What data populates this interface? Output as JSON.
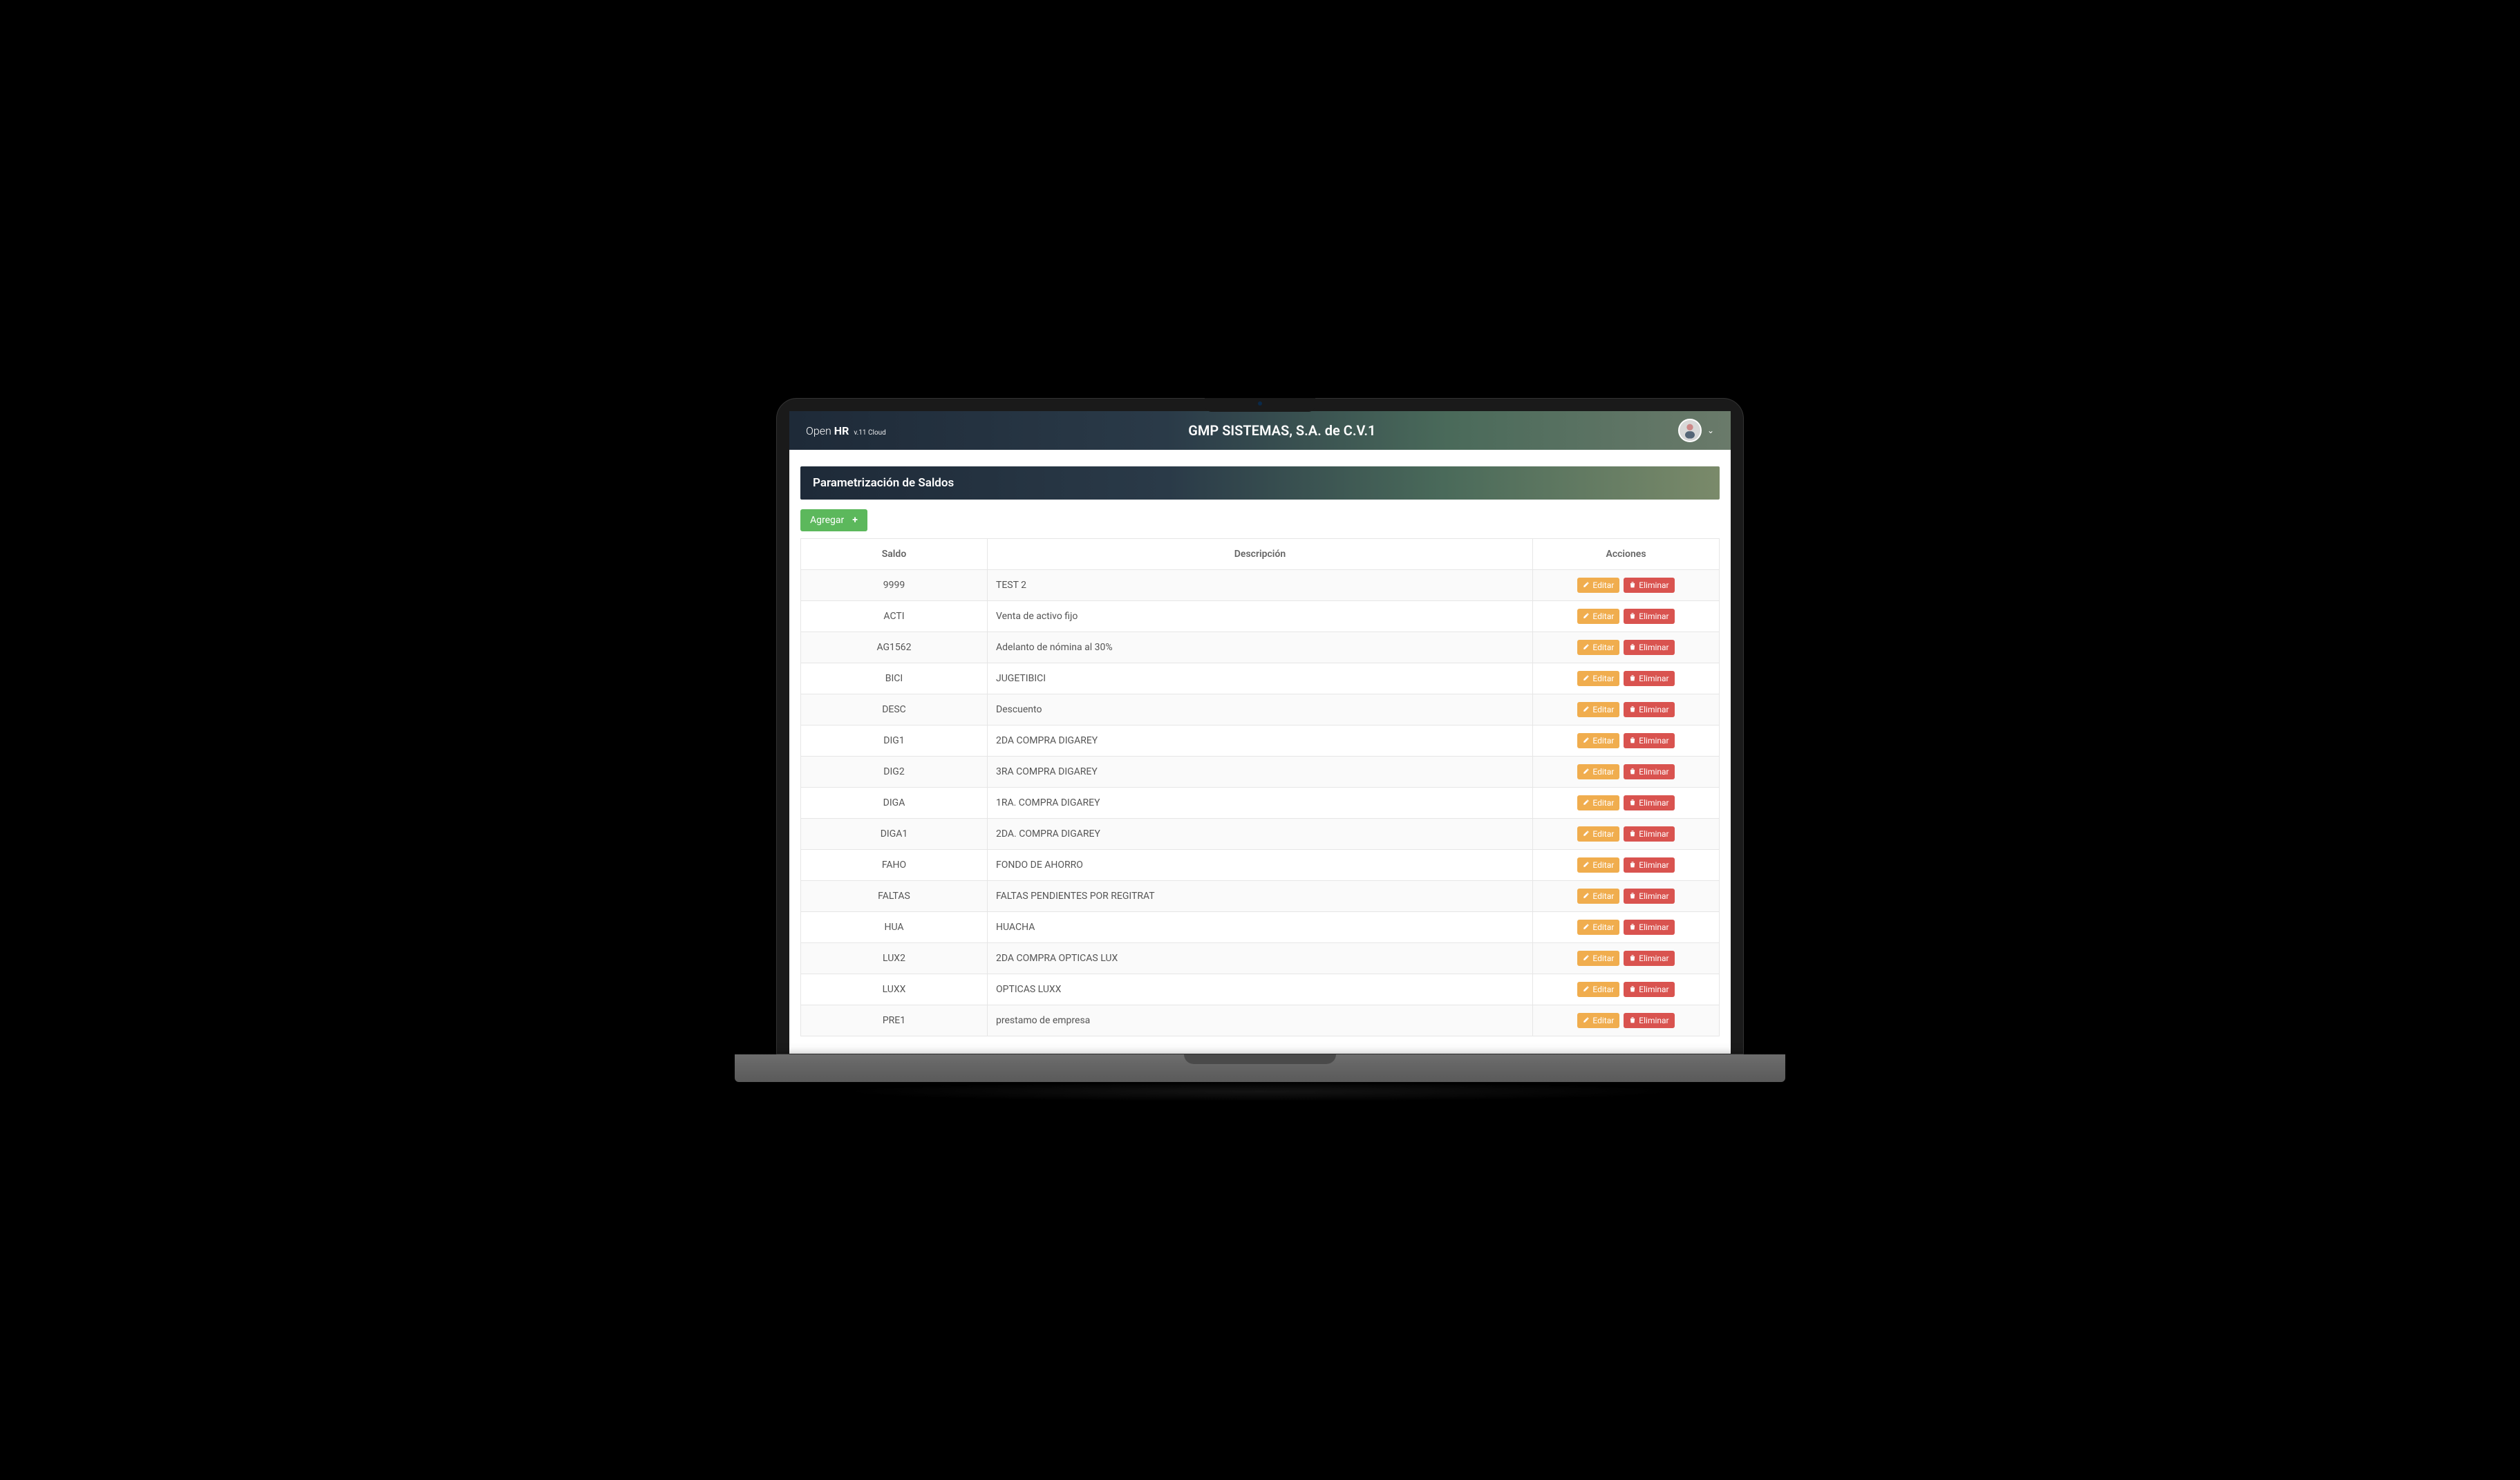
{
  "brand": {
    "open": "Open",
    "hr": "HR",
    "version": "v.11 Cloud"
  },
  "header": {
    "company": "GMP SISTEMAS, S.A. de C.V.1"
  },
  "page": {
    "title": "Parametrización de Saldos",
    "add_label": "Agregar"
  },
  "table": {
    "columns": {
      "saldo": "Saldo",
      "descripcion": "Descripción",
      "acciones": "Acciones"
    },
    "action_labels": {
      "edit": "Editar",
      "delete": "Eliminar"
    },
    "rows": [
      {
        "saldo": "9999",
        "descripcion": "TEST 2"
      },
      {
        "saldo": "ACTI",
        "descripcion": "Venta de activo fijo"
      },
      {
        "saldo": "AG1562",
        "descripcion": "Adelanto de nómina al 30%"
      },
      {
        "saldo": "BICI",
        "descripcion": "JUGETIBICI"
      },
      {
        "saldo": "DESC",
        "descripcion": "Descuento"
      },
      {
        "saldo": "DIG1",
        "descripcion": "2DA COMPRA DIGAREY"
      },
      {
        "saldo": "DIG2",
        "descripcion": "3RA COMPRA DIGAREY"
      },
      {
        "saldo": "DIGA",
        "descripcion": "1RA. COMPRA DIGAREY"
      },
      {
        "saldo": "DIGA1",
        "descripcion": "2DA. COMPRA DIGAREY"
      },
      {
        "saldo": "FAHO",
        "descripcion": "FONDO DE AHORRO"
      },
      {
        "saldo": "FALTAS",
        "descripcion": "FALTAS PENDIENTES POR REGITRAT"
      },
      {
        "saldo": "HUA",
        "descripcion": "HUACHA"
      },
      {
        "saldo": "LUX2",
        "descripcion": "2DA COMPRA OPTICAS LUX"
      },
      {
        "saldo": "LUXX",
        "descripcion": "OPTICAS LUXX"
      },
      {
        "saldo": "PRE1",
        "descripcion": "prestamo de empresa"
      }
    ]
  }
}
